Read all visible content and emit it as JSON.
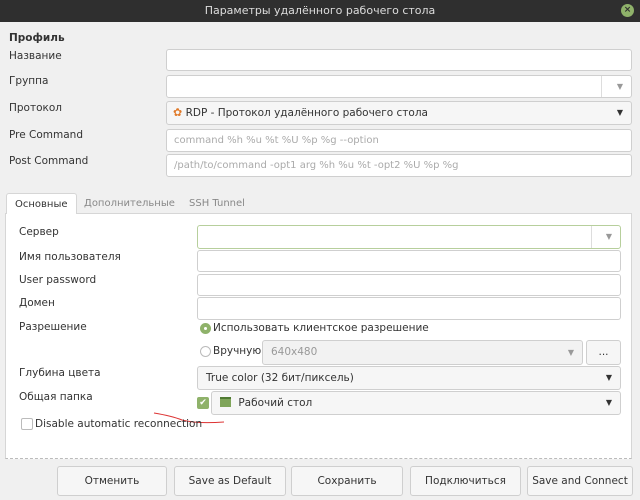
{
  "window": {
    "title": "Параметры удалённого рабочего стола",
    "close_icon": "close-icon"
  },
  "profile": {
    "heading": "Профиль",
    "name_label": "Название",
    "name_value": "",
    "group_label": "Группа",
    "group_value": "",
    "protocol_label": "Протокол",
    "protocol_value": "RDP - Протокол удалённого рабочего стола",
    "pre_label": "Pre Command",
    "pre_placeholder": "command %h %u %t %U %p %g --option",
    "post_label": "Post Command",
    "post_placeholder": "/path/to/command -opt1 arg %h %u %t -opt2 %U %p %g"
  },
  "tabs": [
    {
      "label": "Основные",
      "active": true
    },
    {
      "label": "Дополнительные"
    },
    {
      "label": "SSH Tunnel"
    }
  ],
  "basic": {
    "server_label": "Сервер",
    "server_value": "",
    "user_label": "Имя пользователя",
    "user_value": "",
    "password_label": "User password",
    "password_value": "",
    "domain_label": "Домен",
    "domain_value": "",
    "resolution_label": "Разрешение",
    "res_client": "Использовать клиентское разрешение",
    "res_client_selected": true,
    "res_manual": "Вручную",
    "res_manual_value": "640x480",
    "res_more": "...",
    "color_label": "Глубина цвета",
    "color_value": "True color (32 бит/пиксель)",
    "share_label": "Общая папка",
    "share_checked": true,
    "share_value": "Рабочий стол",
    "disable_reconnect": "Disable automatic reconnection",
    "disable_reconnect_checked": false
  },
  "buttons": {
    "cancel": "Отменить",
    "save_default": "Save as Default",
    "save": "Сохранить",
    "connect": "Подключиться",
    "save_connect": "Save and Connect"
  },
  "colors": {
    "accent": "#8fb26a",
    "titlebar": "#2f2f2f"
  }
}
